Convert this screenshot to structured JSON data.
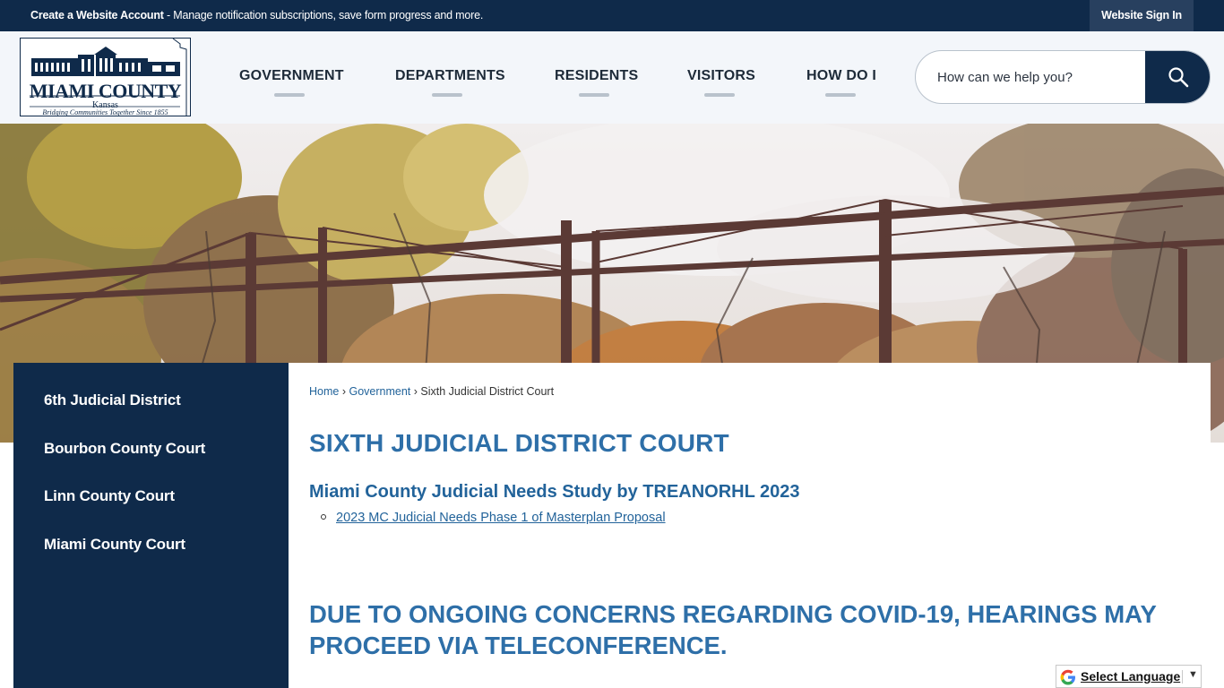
{
  "topbar": {
    "account_bold": "Create a Website Account",
    "account_rest": " - Manage notification subscriptions, save form progress and more.",
    "signin_label": "Website Sign In"
  },
  "logo": {
    "title": "MIAMI COUNTY",
    "state": "Kansas",
    "tagline": "Bridging Communities Together Since 1855"
  },
  "nav": {
    "items": [
      {
        "label": "GOVERNMENT"
      },
      {
        "label": "DEPARTMENTS"
      },
      {
        "label": "RESIDENTS"
      },
      {
        "label": "VISITORS"
      },
      {
        "label": "HOW DO I"
      }
    ]
  },
  "search": {
    "placeholder": "How can we help you?",
    "icon": "search-icon"
  },
  "sidebar": {
    "items": [
      {
        "label": "6th Judicial District"
      },
      {
        "label": "Bourbon County Court"
      },
      {
        "label": "Linn County Court"
      },
      {
        "label": "Miami County Court"
      }
    ]
  },
  "breadcrumb": {
    "home": "Home",
    "sep": "›",
    "parent": "Government",
    "current": "Sixth Judicial District Court"
  },
  "main": {
    "title": "SIXTH JUDICIAL DISTRICT COURT",
    "study_heading": "Miami County Judicial Needs Study by TREANORHL 2023",
    "doc_link": "2023 MC Judicial Needs Phase 1 of Masterplan Proposal",
    "notice": "DUE TO ONGOING CONCERNS REGARDING COVID-19, HEARINGS MAY PROCEED VIA TELECONFERENCE."
  },
  "translate": {
    "label": "Select Language",
    "caret": "▼"
  },
  "colors": {
    "navy": "#0f2a4a",
    "accent_blue": "#2e6fa8",
    "link_blue": "#22639a",
    "header_bg": "#f3f6fa"
  }
}
